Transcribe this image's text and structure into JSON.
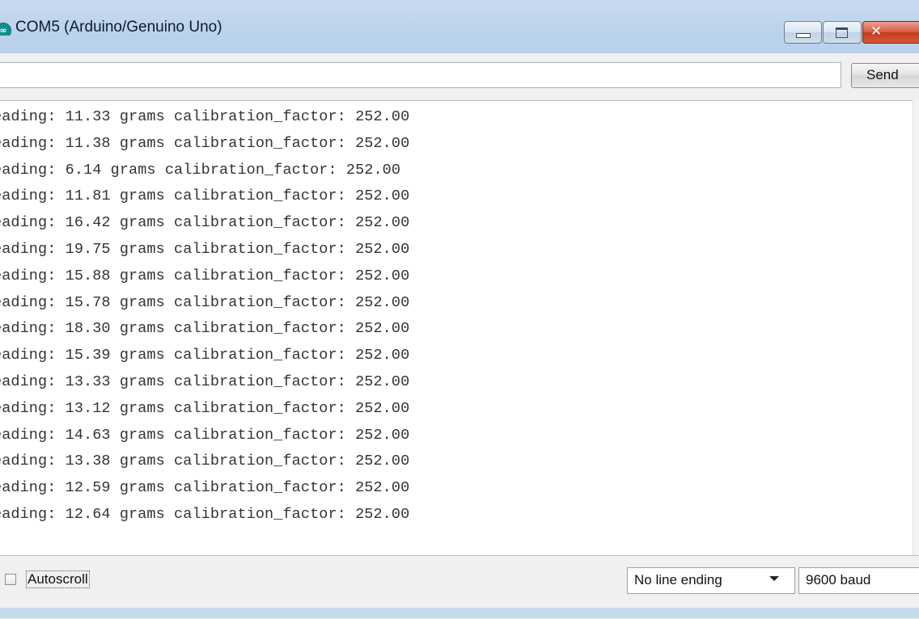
{
  "window": {
    "title": "COM5 (Arduino/Genuino Uno)",
    "icon": "arduino-logo-icon",
    "controls": [
      "minimize-icon",
      "maximize-icon",
      "close-icon"
    ]
  },
  "input": {
    "value": "",
    "send_label": "Send"
  },
  "output": {
    "lines": [
      "eading: 11.33 grams calibration_factor: 252.00",
      "eading: 11.38 grams calibration_factor: 252.00",
      "eading: 6.14 grams calibration_factor: 252.00",
      "eading: 11.81 grams calibration_factor: 252.00",
      "eading: 16.42 grams calibration_factor: 252.00",
      "eading: 19.75 grams calibration_factor: 252.00",
      "eading: 15.88 grams calibration_factor: 252.00",
      "eading: 15.78 grams calibration_factor: 252.00",
      "eading: 18.30 grams calibration_factor: 252.00",
      "eading: 15.39 grams calibration_factor: 252.00",
      "eading: 13.33 grams calibration_factor: 252.00",
      "eading: 13.12 grams calibration_factor: 252.00",
      "eading: 14.63 grams calibration_factor: 252.00",
      "eading: 13.38 grams calibration_factor: 252.00",
      "eading: 12.59 grams calibration_factor: 252.00",
      "eading: 12.64 grams calibration_factor: 252.00"
    ]
  },
  "bottom": {
    "autoscroll_label": "Autoscroll",
    "autoscroll_checked": false,
    "line_ending": "No line ending",
    "baud": "9600 baud"
  }
}
